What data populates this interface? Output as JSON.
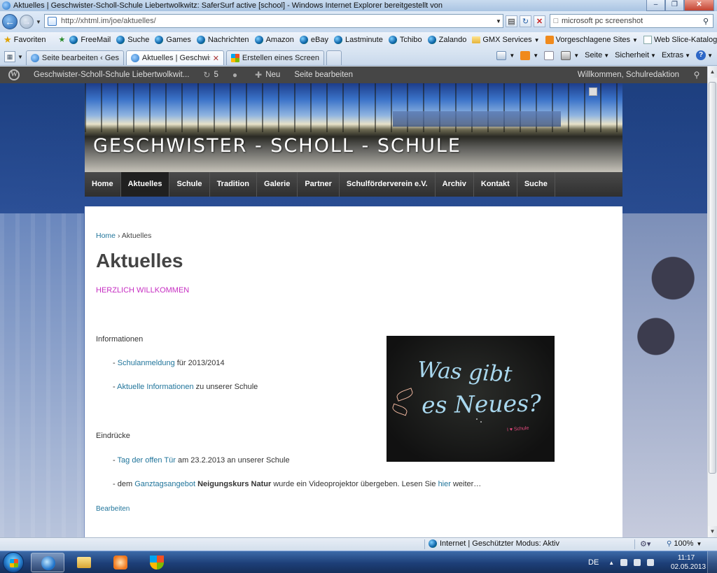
{
  "window": {
    "title": "Aktuelles | Geschwister-Scholl-Schule Liebertwolkwitz: SaferSurf active [school] - Windows Internet Explorer bereitgestellt von",
    "minimize": "0",
    "maximize": "1",
    "close": "r"
  },
  "address": {
    "url": "http://xhtml.im/joe/aktuelles/",
    "search_value": "microsoft pc screenshot"
  },
  "favorites": {
    "label": "Favoriten",
    "items": [
      "FreeMail",
      "Suche",
      "Games",
      "Nachrichten",
      "Amazon",
      "eBay",
      "Lastminute",
      "Tchibo",
      "Zalando"
    ],
    "gmx": "GMX Services",
    "suggested": "Vorgeschlagene Sites",
    "webslice": "Web Slice-Katalog"
  },
  "tabs": [
    {
      "label": "Seite bearbeiten ‹ Geschwi..."
    },
    {
      "label": "Aktuelles | Geschwister..."
    },
    {
      "label": "Erstellen eines Screenshots..."
    }
  ],
  "commandbar": {
    "page": "Seite",
    "safety": "Sicherheit",
    "extras": "Extras",
    "help": "?"
  },
  "wpadmin": {
    "logo": "W",
    "site_name": "Geschwister-Scholl-Schule Liebertwolkwit...",
    "updates": "5",
    "new": "Neu",
    "edit_page": "Seite bearbeiten",
    "greeting": "Willkommen, Schulredaktion"
  },
  "site": {
    "title": "GESCHWISTER - SCHOLL - SCHULE",
    "nav": [
      "Home",
      "Aktuelles",
      "Schule",
      "Tradition",
      "Galerie",
      "Partner",
      "Schulförderverein e.V.",
      "Archiv",
      "Kontakt",
      "Suche"
    ],
    "active_nav": "Aktuelles"
  },
  "content": {
    "breadcrumb_home": "Home",
    "breadcrumb_sep": "›",
    "breadcrumb_current": "Aktuelles",
    "title": "Aktuelles",
    "welcome": "HERZLICH WILLKOMMEN",
    "info_heading": "Informationen",
    "b1_dash": "-",
    "b1_link": "Schulanmeldung",
    "b1_rest": "für 2013/2014",
    "b2_dash": "-",
    "b2_link": "Aktuelle Informationen",
    "b2_rest": "zu unserer Schule",
    "impressions_heading": "Eindrücke",
    "b3_dash": "-",
    "b3_link": "Tag der offen Tür",
    "b3_rest": "am 23.2.2013 an unserer Schule",
    "b4_pre": "- dem",
    "b4_link": "Ganztagsangebot",
    "b4_bold": "Neigungskurs Natur",
    "b4_mid": "wurde ein Videoprojektor übergeben. Lesen Sie",
    "b4_link2": "hier",
    "b4_post": "weiter…",
    "edit": "Bearbeiten",
    "chalk_line1": "Was gibt",
    "chalk_line2": "es Neues?",
    "chalk_signature": "I ♥ Schule"
  },
  "statusbar": {
    "zone": "Internet | Geschützter Modus: Aktiv",
    "zoom": "100%"
  },
  "taskbar": {
    "language": "DE",
    "time": "11:17",
    "date": "02.05.2013"
  }
}
